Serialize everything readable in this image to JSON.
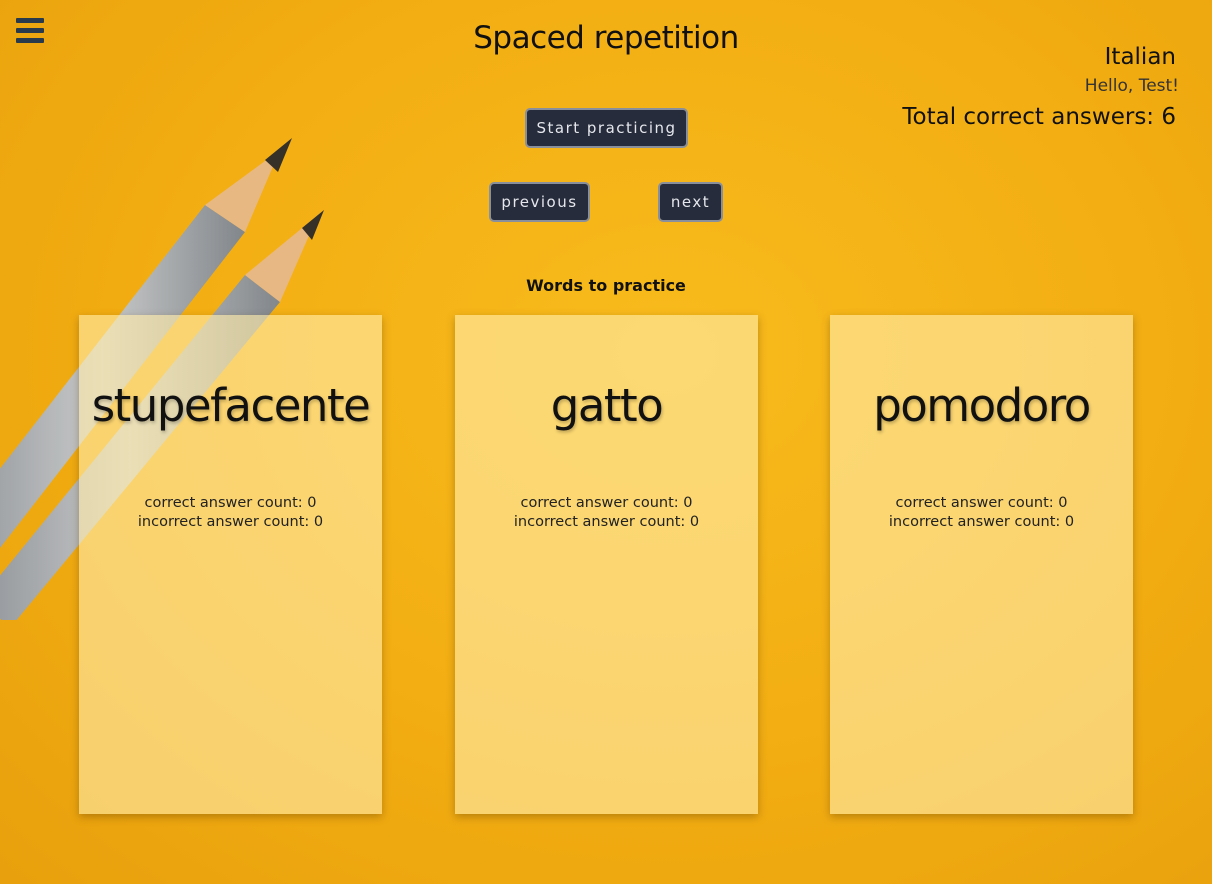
{
  "header": {
    "menu_icon": "hamburger-menu-icon",
    "title": "Spaced repetition"
  },
  "user": {
    "language": "Italian",
    "greeting": "Hello, Test!",
    "total_correct": "Total correct answers: 6"
  },
  "controls": {
    "start_label": "Start practicing",
    "previous_label": "previous",
    "next_label": "next"
  },
  "words_section": {
    "heading": "Words to practice",
    "cards": [
      {
        "word": "stupefacente",
        "correct": "correct answer count: 0",
        "incorrect": "incorrect answer count: 0"
      },
      {
        "word": "gatto",
        "correct": "correct answer count: 0",
        "incorrect": "incorrect answer count: 0"
      },
      {
        "word": "pomodoro",
        "correct": "correct answer count: 0",
        "incorrect": "incorrect answer count: 0"
      }
    ]
  },
  "colors": {
    "background": "#f4b014",
    "button_bg": "#262c3b",
    "button_text": "#e5e7ed",
    "menu_icon": "#2a3a4d"
  }
}
